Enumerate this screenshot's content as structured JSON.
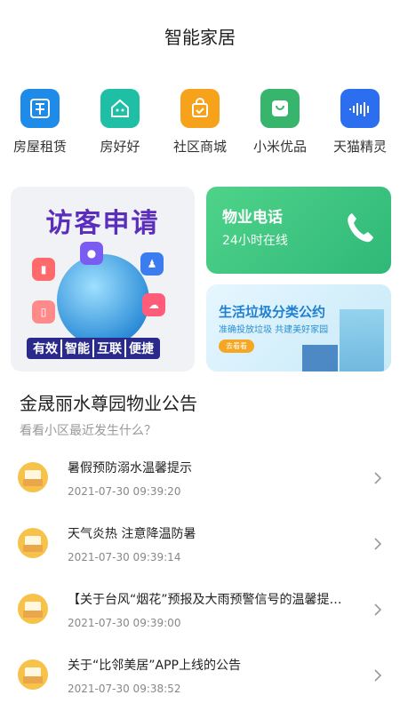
{
  "page": {
    "title": "智能家居"
  },
  "apps": [
    {
      "label": "房屋租赁",
      "icon": "house-rent-icon",
      "color": "#1f8be8"
    },
    {
      "label": "房好好",
      "icon": "house-home-icon",
      "color": "#1fbfa6"
    },
    {
      "label": "社区商城",
      "icon": "shopping-bag-icon",
      "color": "#f6a21a"
    },
    {
      "label": "小米优品",
      "icon": "mi-logo-icon",
      "color": "#37b56d"
    },
    {
      "label": "天猫精灵",
      "icon": "tmall-genie-icon",
      "color": "#2b6ff0"
    }
  ],
  "banner_visitor": {
    "title": "访客申请",
    "tags": [
      "有效",
      "智能",
      "互联",
      "便捷"
    ]
  },
  "card_phone": {
    "title": "物业电话",
    "subtitle": "24小时在线",
    "color": "#3ec67f"
  },
  "card_trash": {
    "title": "生活垃圾分类公约",
    "subtitle": "准确投放垃圾  共建美好家园",
    "button": "去看看"
  },
  "notice": {
    "title": "金晟丽水尊园物业公告",
    "subtitle": "看看小区最近发生什么？",
    "items": [
      {
        "title": "暑假预防溺水温馨提示",
        "date": "2021-07-30 09:39:20"
      },
      {
        "title": "天气炎热 注意降温防暑",
        "date": "2021-07-30 09:39:14"
      },
      {
        "title": "【关于台风“烟花”预报及大雨预警信号的温馨提…",
        "date": "2021-07-30 09:39:00"
      },
      {
        "title": "关于“比邻美居”APP上线的公告",
        "date": "2021-07-30 09:38:52"
      }
    ]
  }
}
